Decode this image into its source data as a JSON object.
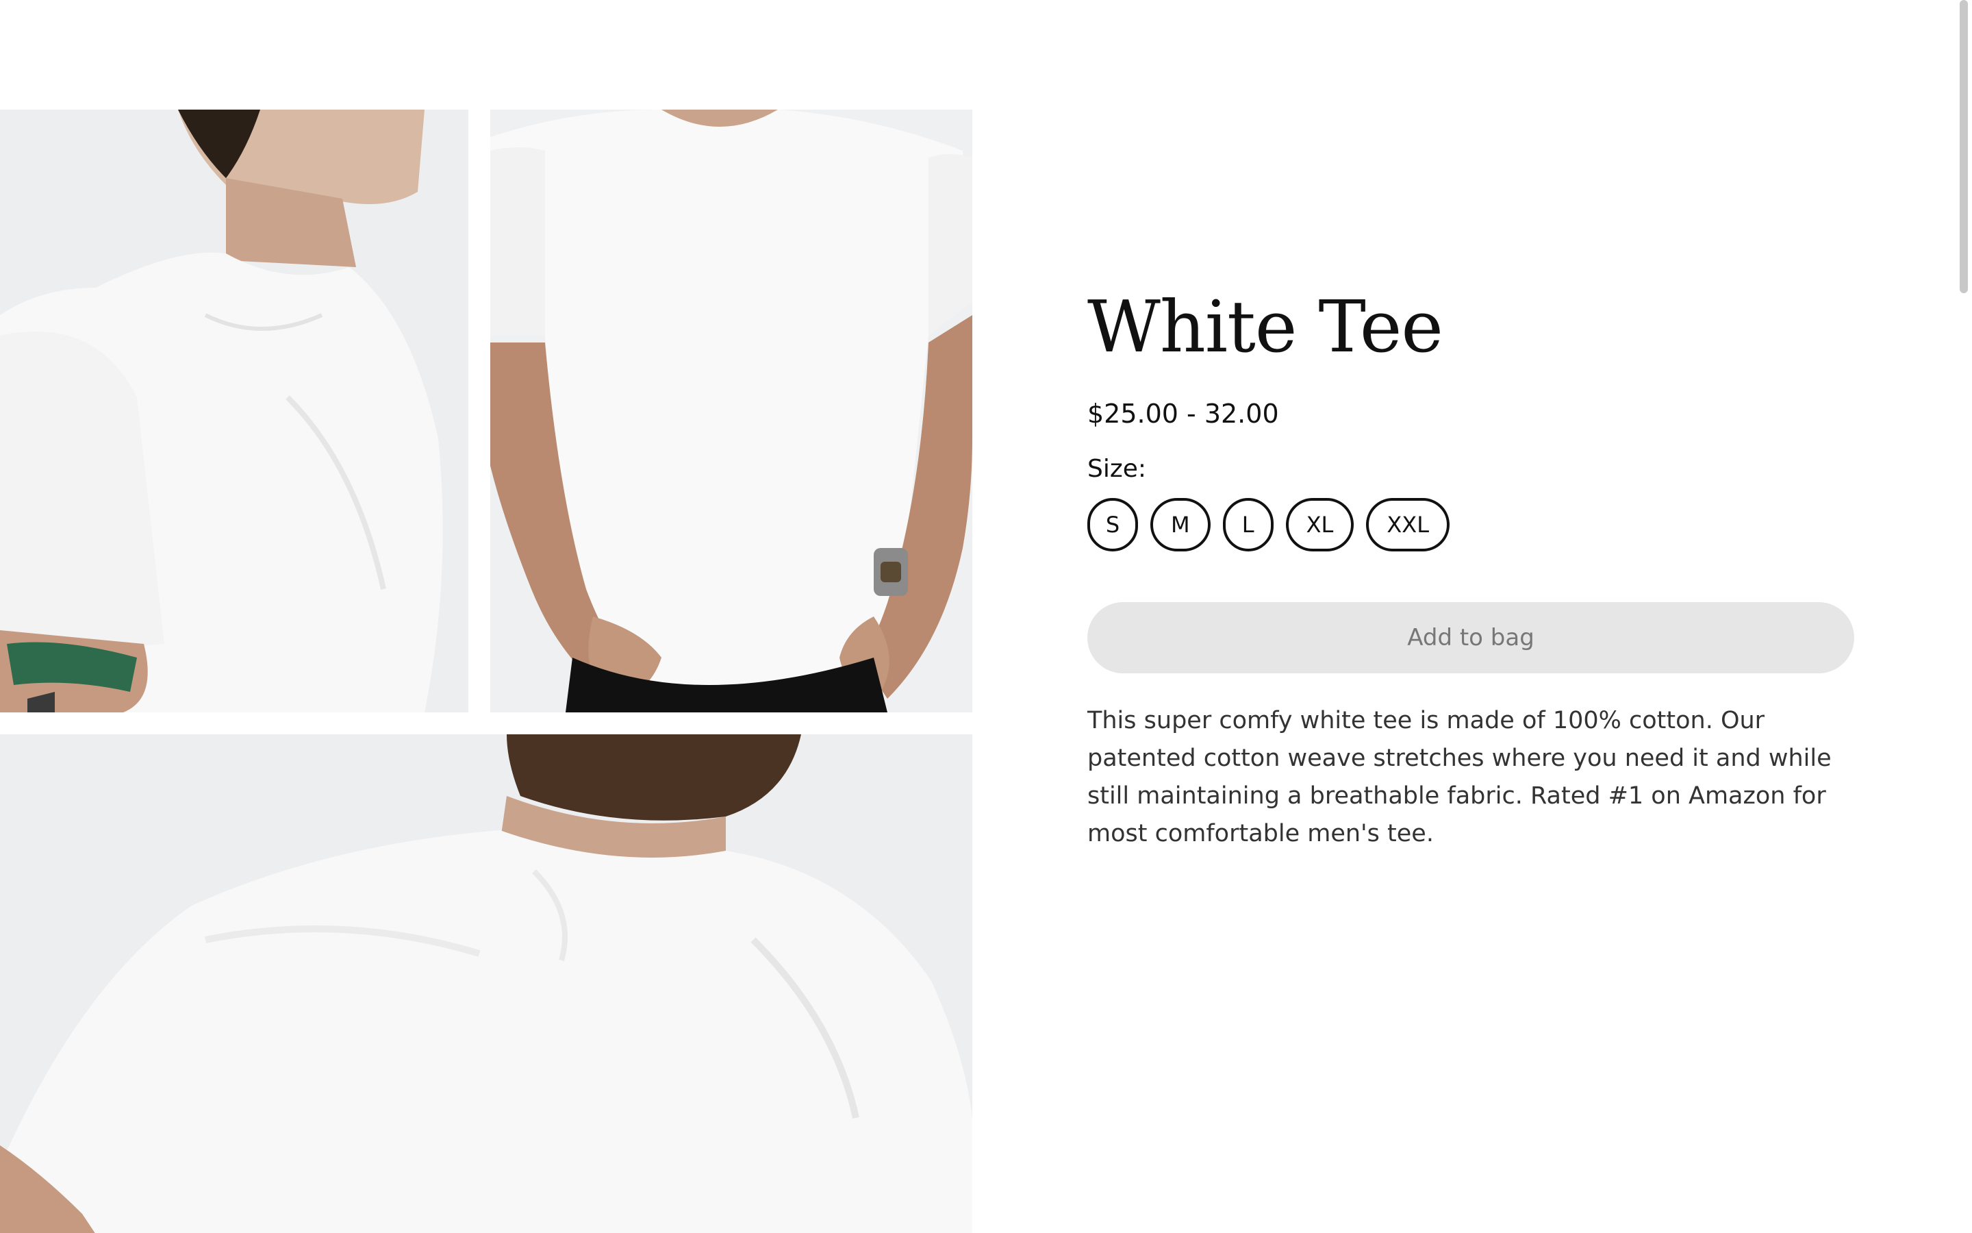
{
  "product": {
    "title": "White Tee",
    "price": "$25.00 - 32.00",
    "size_label": "Size:",
    "sizes": [
      "S",
      "M",
      "L",
      "XL",
      "XXL"
    ],
    "add_to_bag_label": "Add to bag",
    "description": "This super comfy white tee is made of 100% cotton. Our patented cotton weave stretches where you need it and while still maintaining a breathable fabric. Rated #1 on Amazon for most comfortable men's tee."
  },
  "gallery": {
    "photos": [
      {
        "alt": "Side view of model wearing white tee"
      },
      {
        "alt": "Front view of model wearing white tee"
      },
      {
        "alt": "Back view of model wearing white tee"
      }
    ]
  },
  "colors": {
    "button_disabled_bg": "#e6e6e6",
    "button_disabled_text": "#777777",
    "text_primary": "#111111",
    "text_body": "#333333"
  }
}
